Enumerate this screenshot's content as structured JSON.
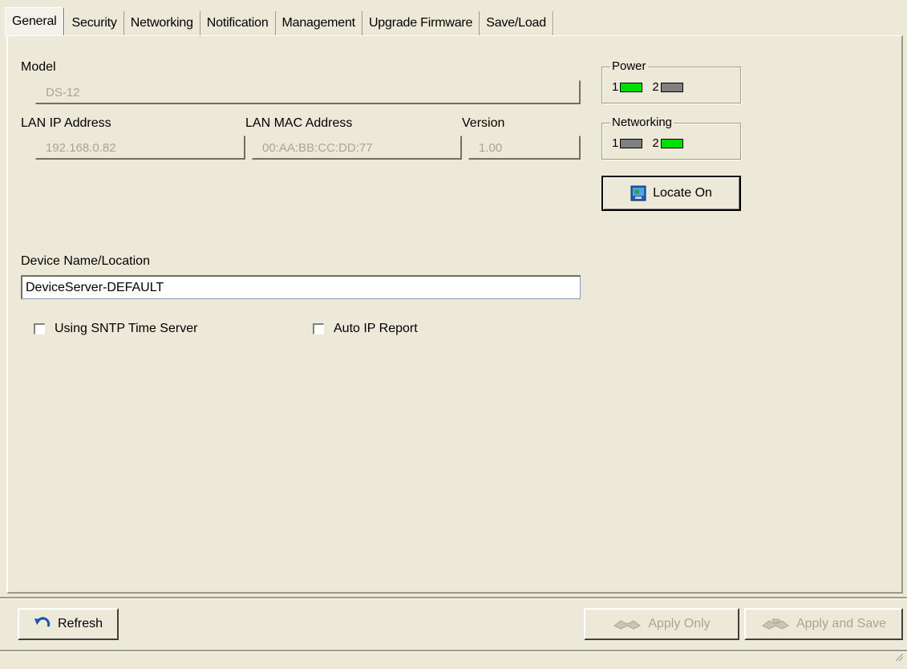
{
  "tabs": [
    {
      "label": "General",
      "active": true
    },
    {
      "label": "Security",
      "active": false
    },
    {
      "label": "Networking",
      "active": false
    },
    {
      "label": "Notification",
      "active": false
    },
    {
      "label": "Management",
      "active": false
    },
    {
      "label": "Upgrade Firmware",
      "active": false
    },
    {
      "label": "Save/Load",
      "active": false
    }
  ],
  "general": {
    "model_label": "Model",
    "model_value": "DS-12",
    "lan_ip_label": "LAN IP Address",
    "lan_ip_value": "192.168.0.82",
    "lan_mac_label": "LAN MAC Address",
    "lan_mac_value": "00:AA:BB:CC:DD:77",
    "version_label": "Version",
    "version_value": "1.00",
    "device_name_label": "Device Name/Location",
    "device_name_value": "DeviceServer-DEFAULT",
    "sntp_label": "Using SNTP Time Server",
    "sntp_checked": false,
    "auto_ip_label": "Auto IP Report",
    "auto_ip_checked": false
  },
  "power": {
    "title": "Power",
    "leds": [
      {
        "num": "1",
        "color": "#00e000",
        "icon": "led-on"
      },
      {
        "num": "2",
        "color": "#808080",
        "icon": "led-off"
      }
    ]
  },
  "networking": {
    "title": "Networking",
    "leds": [
      {
        "num": "1",
        "color": "#808080",
        "icon": "led-off"
      },
      {
        "num": "2",
        "color": "#00e000",
        "icon": "led-on"
      }
    ]
  },
  "buttons": {
    "locate_label": "Locate On",
    "refresh_label": "Refresh",
    "apply_only_label": "Apply Only",
    "apply_save_label": "Apply and Save"
  }
}
